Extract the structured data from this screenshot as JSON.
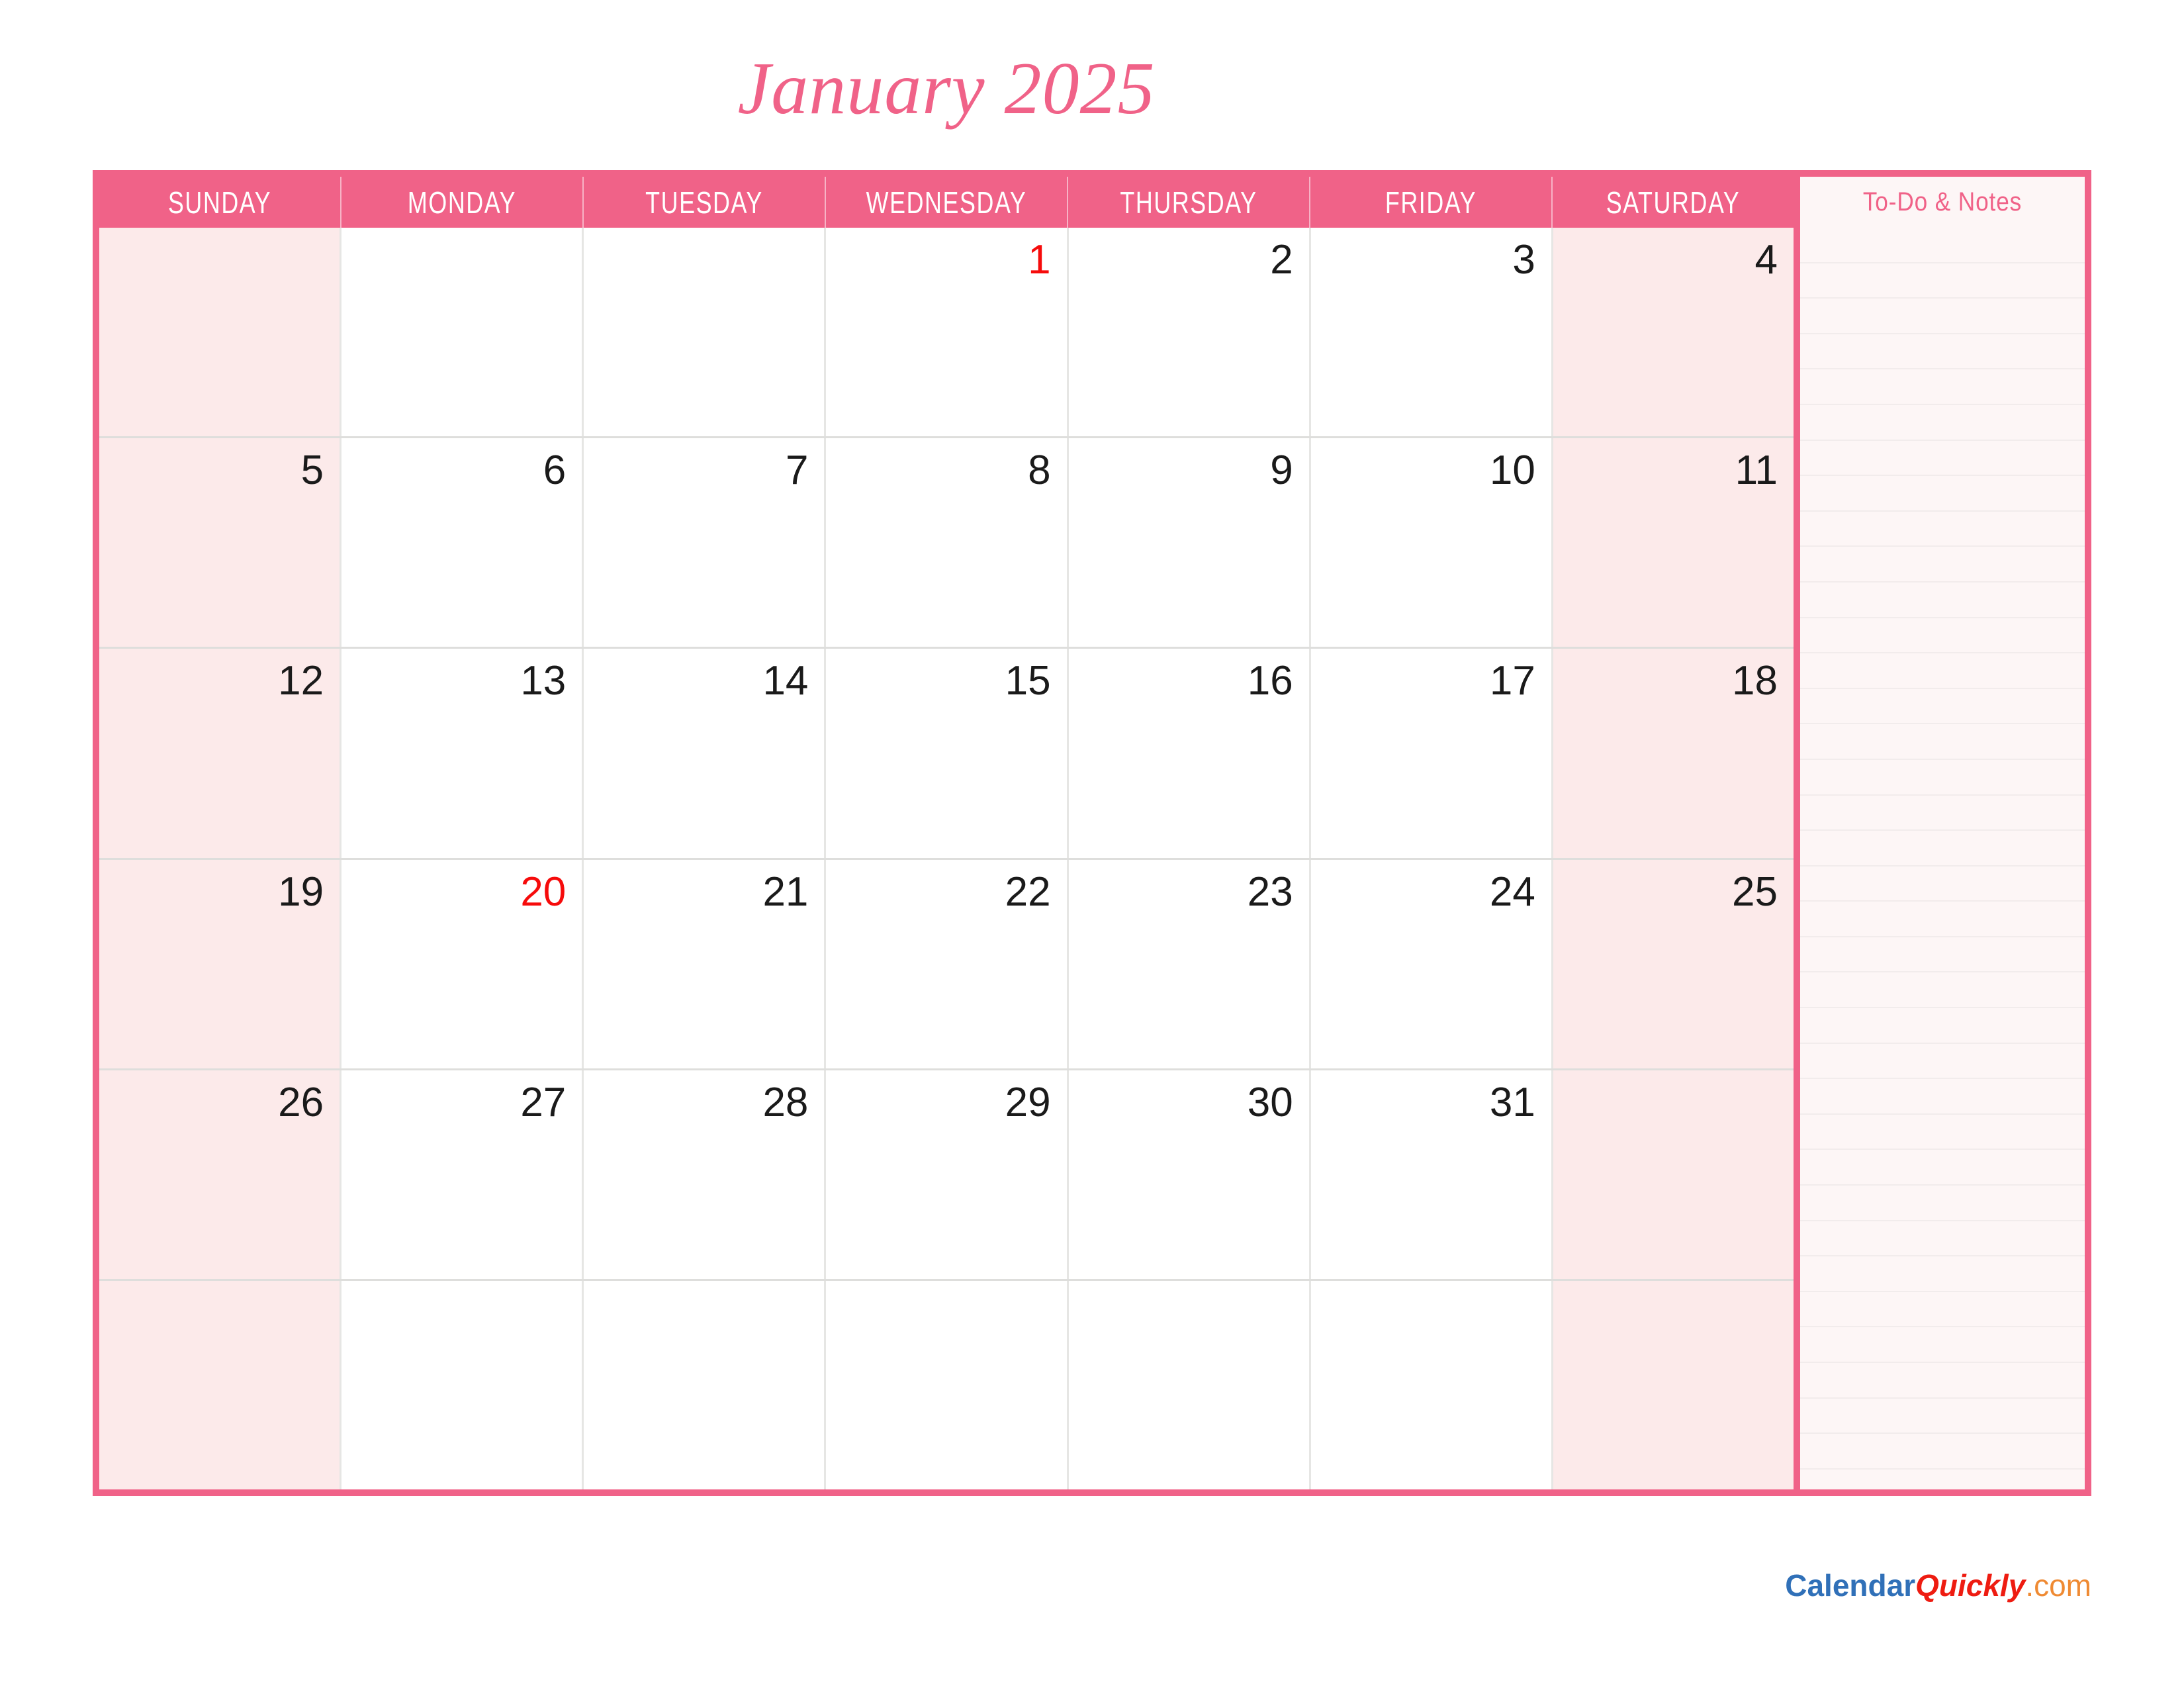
{
  "document": {
    "title": "January 2025",
    "month": "January",
    "year": "2025"
  },
  "theme": {
    "accent_pink": "#f06288",
    "weekend_bg": "#fceaea",
    "notes_bg": "#fdf6f6",
    "holiday_red": "#f60b0b",
    "gridline": "#dededc"
  },
  "weekday_headers": [
    "SUNDAY",
    "MONDAY",
    "TUESDAY",
    "WEDNESDAY",
    "THURSDAY",
    "FRIDAY",
    "SATURDAY"
  ],
  "notes_panel": {
    "title": "To-Do & Notes",
    "line_count": 36,
    "lines": []
  },
  "calendar_grid": {
    "rows": 6,
    "columns": 7,
    "weekend_columns": [
      0,
      6
    ],
    "weeks": [
      [
        {
          "day": "",
          "holiday": false
        },
        {
          "day": "",
          "holiday": false
        },
        {
          "day": "",
          "holiday": false
        },
        {
          "day": "1",
          "holiday": true
        },
        {
          "day": "2",
          "holiday": false
        },
        {
          "day": "3",
          "holiday": false
        },
        {
          "day": "4",
          "holiday": false
        }
      ],
      [
        {
          "day": "5",
          "holiday": false
        },
        {
          "day": "6",
          "holiday": false
        },
        {
          "day": "7",
          "holiday": false
        },
        {
          "day": "8",
          "holiday": false
        },
        {
          "day": "9",
          "holiday": false
        },
        {
          "day": "10",
          "holiday": false
        },
        {
          "day": "11",
          "holiday": false
        }
      ],
      [
        {
          "day": "12",
          "holiday": false
        },
        {
          "day": "13",
          "holiday": false
        },
        {
          "day": "14",
          "holiday": false
        },
        {
          "day": "15",
          "holiday": false
        },
        {
          "day": "16",
          "holiday": false
        },
        {
          "day": "17",
          "holiday": false
        },
        {
          "day": "18",
          "holiday": false
        }
      ],
      [
        {
          "day": "19",
          "holiday": false
        },
        {
          "day": "20",
          "holiday": true
        },
        {
          "day": "21",
          "holiday": false
        },
        {
          "day": "22",
          "holiday": false
        },
        {
          "day": "23",
          "holiday": false
        },
        {
          "day": "24",
          "holiday": false
        },
        {
          "day": "25",
          "holiday": false
        }
      ],
      [
        {
          "day": "26",
          "holiday": false
        },
        {
          "day": "27",
          "holiday": false
        },
        {
          "day": "28",
          "holiday": false
        },
        {
          "day": "29",
          "holiday": false
        },
        {
          "day": "30",
          "holiday": false
        },
        {
          "day": "31",
          "holiday": false
        },
        {
          "day": "",
          "holiday": false
        }
      ],
      [
        {
          "day": "",
          "holiday": false
        },
        {
          "day": "",
          "holiday": false
        },
        {
          "day": "",
          "holiday": false
        },
        {
          "day": "",
          "holiday": false
        },
        {
          "day": "",
          "holiday": false
        },
        {
          "day": "",
          "holiday": false
        },
        {
          "day": "",
          "holiday": false
        }
      ]
    ]
  },
  "footer": {
    "logo_calendar": "Calendar",
    "logo_quickly": "Quickly",
    "logo_com": ".com"
  }
}
